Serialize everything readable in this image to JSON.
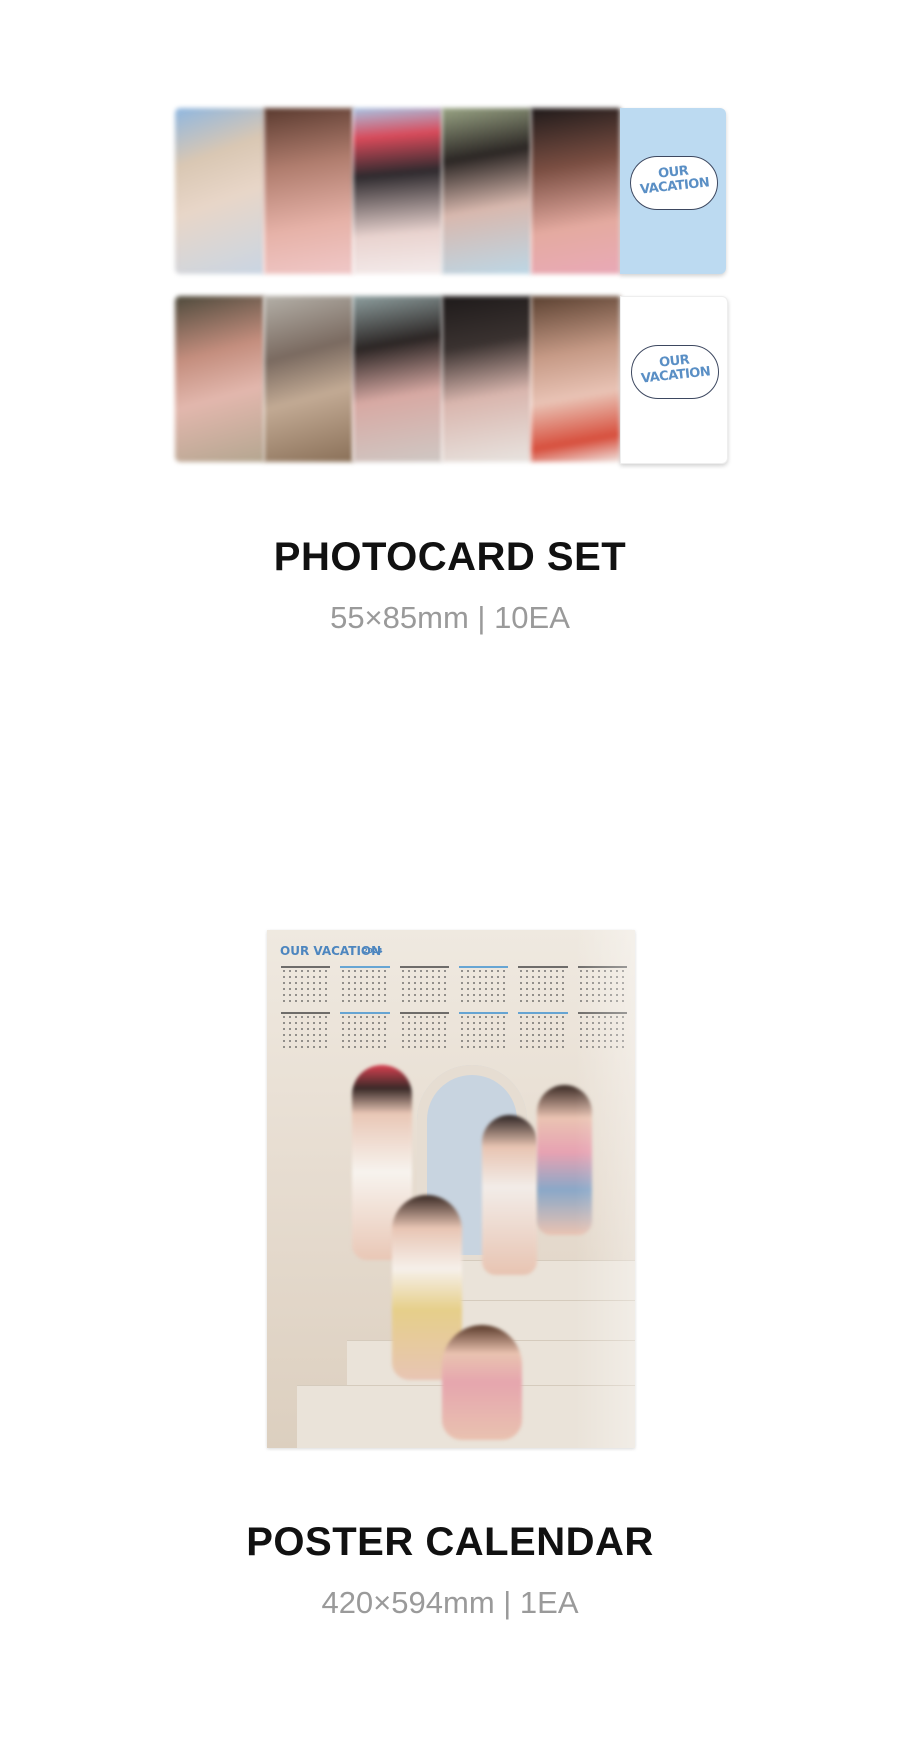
{
  "photocard_set": {
    "title": "PHOTOCARD SET",
    "spec": "55×85mm | 10EA",
    "logo_card_text": "OUR VACATION",
    "colors": {
      "logo_card_bg_row1": "#bcdaf1",
      "logo_card_bg_row2": "#ffffff",
      "logo_accent": "#5a8fc5"
    }
  },
  "poster_calendar": {
    "title": "POSTER CALENDAR",
    "spec": "420×594mm | 1EA",
    "poster_brand": "OUR VACATION",
    "poster_year": "2024"
  }
}
